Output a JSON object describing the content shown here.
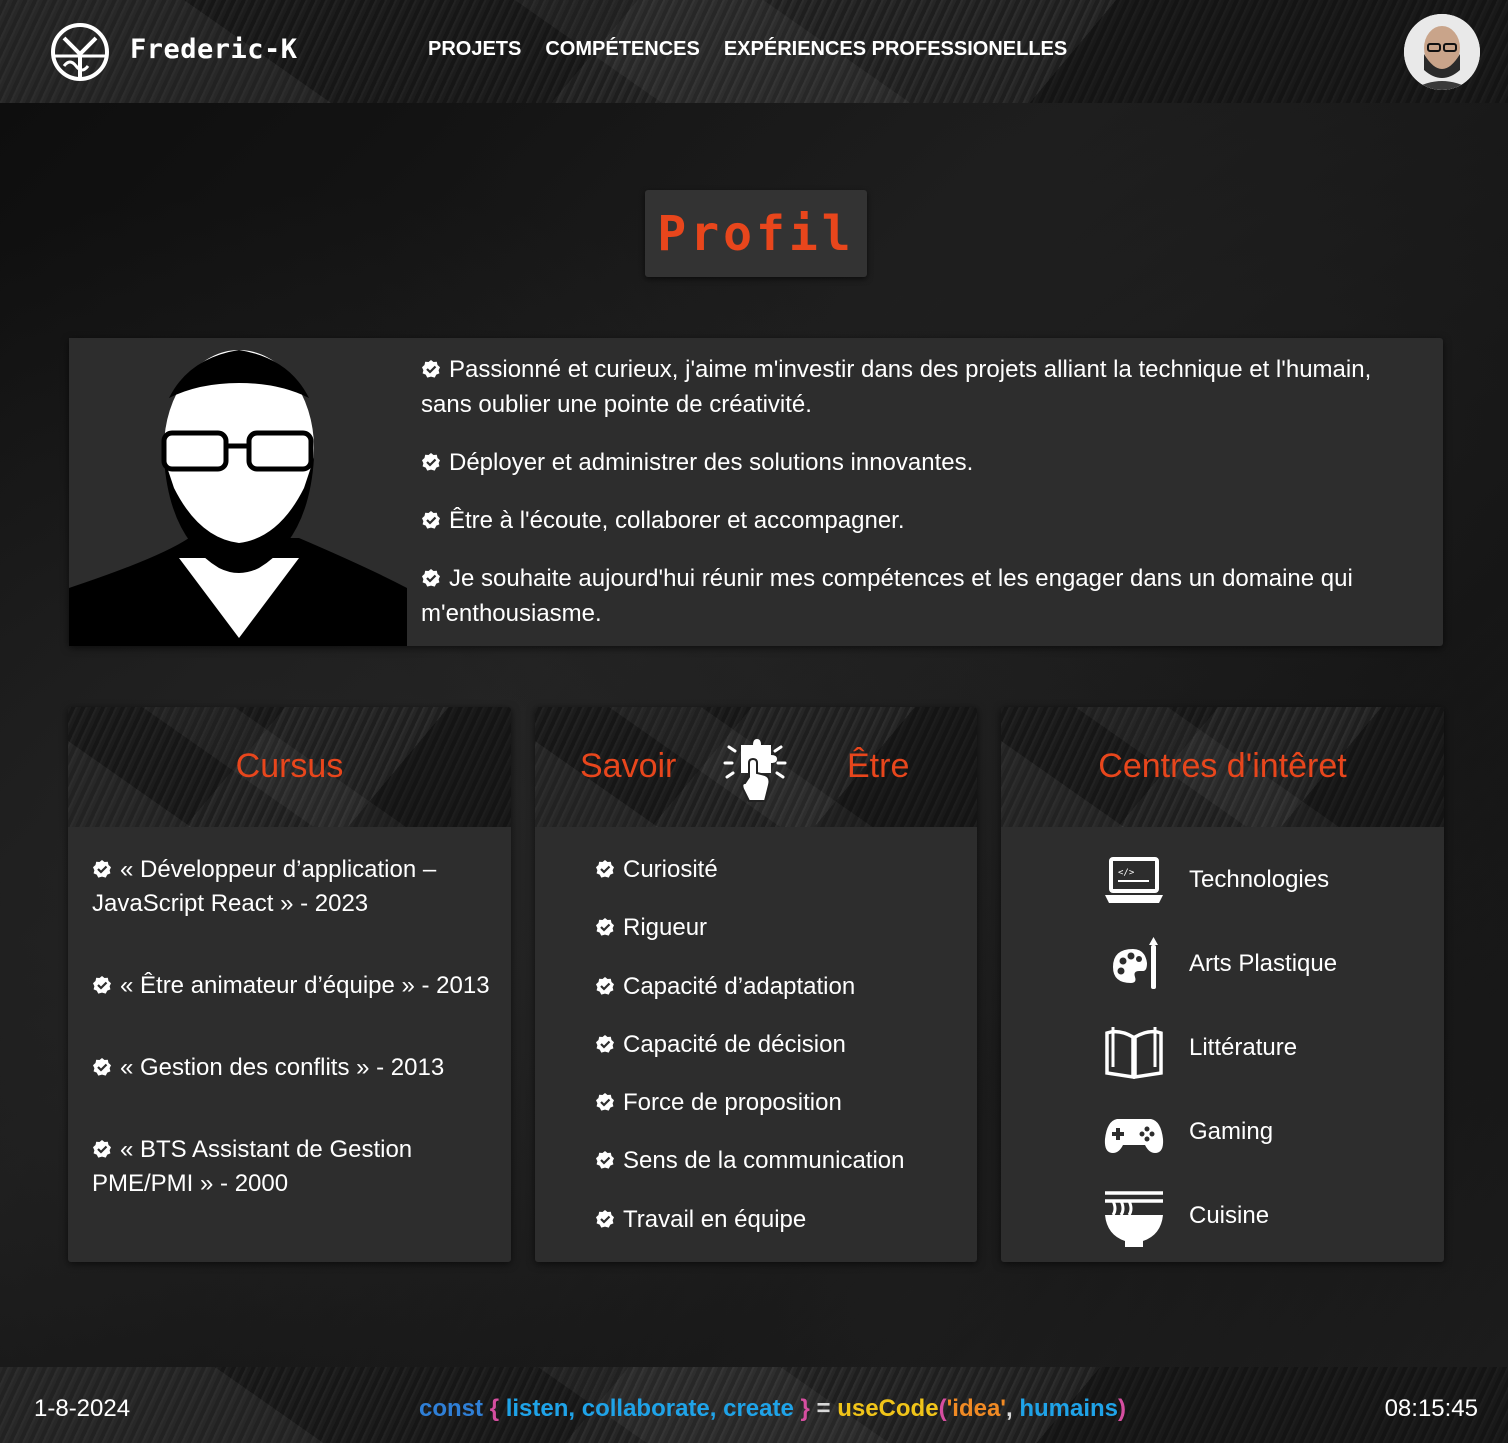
{
  "header": {
    "brand": "Frederic-K",
    "nav": [
      "PROJETS",
      "COMPÉTENCES",
      "EXPÉRIENCES PROFESSIONELLES"
    ]
  },
  "title": "Profil",
  "profile": {
    "items": [
      "Passionné et curieux, j'aime m'investir dans des projets alliant la technique et l'humain, sans oublier une pointe de créativité.",
      "Déployer et administrer des solutions innovantes.",
      "Être à l'écoute, collaborer et accompagner.",
      "Je souhaite aujourd'hui réunir mes compétences et les engager dans un domaine qui m'enthousiasme."
    ]
  },
  "cursus": {
    "title": "Cursus",
    "items": [
      "« Développeur d’application – JavaScript React » - 2023",
      "« Être animateur d’équipe » - 2013",
      "« Gestion des conflits » - 2013",
      "« BTS Assistant de Gestion PME/PMI » - 2000"
    ]
  },
  "savoir_etre": {
    "title_left": "Savoir",
    "title_right": "Être",
    "icon": "puzzle-hand-icon",
    "items": [
      "Curiosité",
      "Rigueur",
      "Capacité d’adaptation",
      "Capacité de décision",
      "Force de proposition",
      "Sens de la communication",
      "Travail en équipe"
    ]
  },
  "interests": {
    "title": "Centres d'intêret",
    "items": [
      {
        "label": "Technologies",
        "icon": "laptop-code-icon"
      },
      {
        "label": "Arts Plastique",
        "icon": "palette-brush-icon"
      },
      {
        "label": "Littérature",
        "icon": "open-book-icon"
      },
      {
        "label": "Gaming",
        "icon": "gamepad-icon"
      },
      {
        "label": "Cuisine",
        "icon": "noodle-bowl-icon"
      }
    ]
  },
  "footer": {
    "date": "1-8-2024",
    "time": "08:15:45",
    "code": {
      "kw": "const",
      "open": "{",
      "vars": "listen, collaborate, create",
      "close": "}",
      "eq": "=",
      "fn": "useCode",
      "popen": "(",
      "str": "'idea'",
      "comma": ",",
      "arg": "humains",
      "pclose": ")"
    }
  },
  "colors": {
    "accent": "#e8461c",
    "panel": "#2d2d2d",
    "background": "#121212"
  }
}
